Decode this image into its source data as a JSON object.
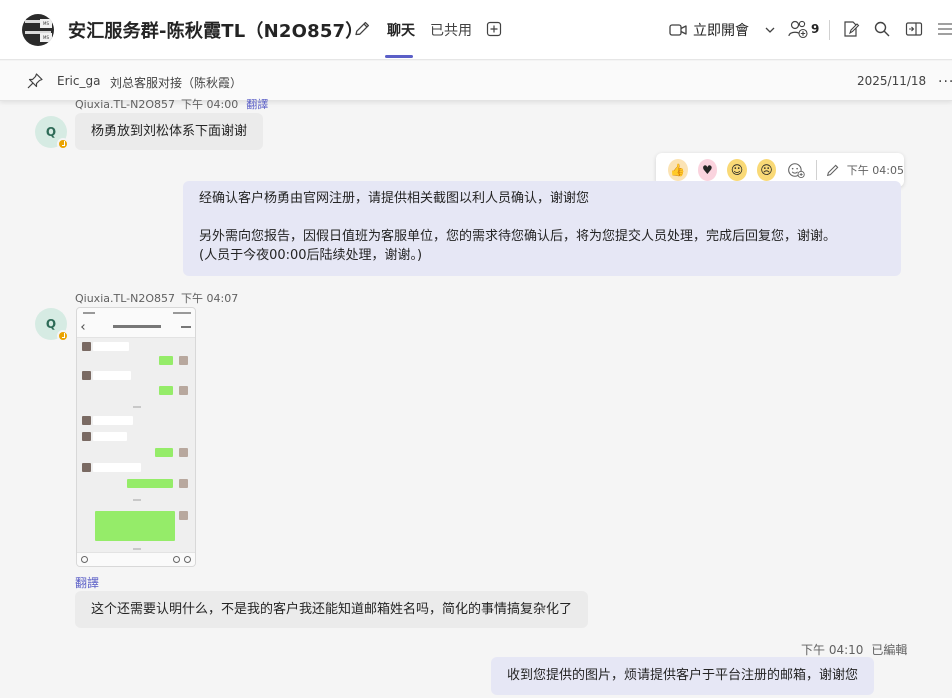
{
  "header": {
    "title": "安汇服务群-陈秋霞TL（N2O857）",
    "tabs": [
      "聊天",
      "已共用"
    ],
    "meet_label": "立即開會",
    "participant_count": "9",
    "accent_color": "#5b5fc7"
  },
  "pinned": {
    "sender": "Eric_ga",
    "text": "刘总客服对接（陈秋霞）",
    "date": "2025/11/18"
  },
  "messages": [
    {
      "sender": "Qiuxia.TL-N2O857",
      "time": "下午 04:00",
      "translate": "翻譯",
      "avatar_initial": "Q",
      "text": "杨勇放到刘松体系下面谢谢"
    },
    {
      "time": "下午 04:05",
      "lines": [
        "经确认客户杨勇由官网注册，请提供相关截图以利人员确认，谢谢您",
        "另外需向您报告，因假日值班为客服单位，您的需求待您确认后，将为您提交人员处理，完成后回复您，谢谢。",
        "(人员于今夜00:00后陆续处理，谢谢。)"
      ]
    },
    {
      "sender": "Qiuxia.TL-N2O857",
      "time": "下午 04:07",
      "avatar_initial": "Q",
      "translate": "翻譯",
      "text": "这个还需要认明什么，不是我的客户我还能知道邮箱姓名吗，简化的事情搞复杂化了"
    },
    {
      "time": "下午 04:10",
      "edited": "已編輯",
      "text": "收到您提供的图片，烦请提供客户于平台注册的邮箱，谢谢您"
    }
  ]
}
